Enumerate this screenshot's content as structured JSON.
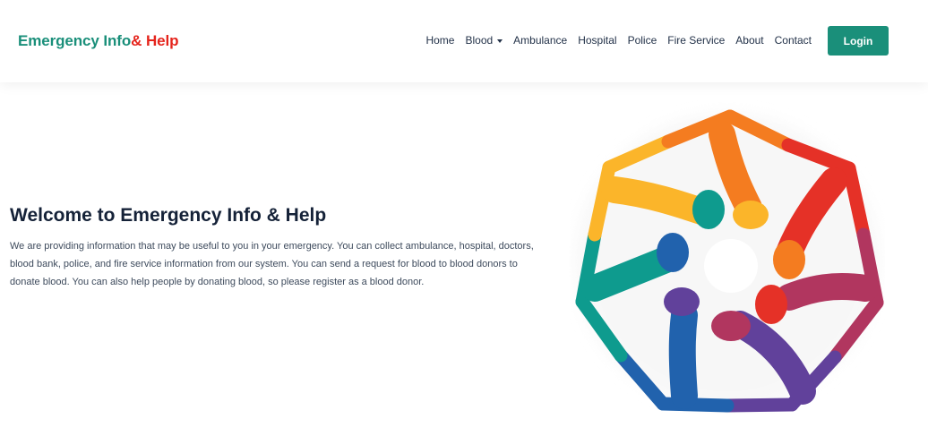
{
  "header": {
    "brand_text": "Emergency Info",
    "brand_amp": "& Help",
    "nav": [
      {
        "label": "Home"
      },
      {
        "label": "Blood",
        "dropdown": true
      },
      {
        "label": "Ambulance"
      },
      {
        "label": "Hospital"
      },
      {
        "label": "Police"
      },
      {
        "label": "Fire Service"
      },
      {
        "label": "About"
      },
      {
        "label": "Contact"
      }
    ],
    "login_label": "Login"
  },
  "hero": {
    "title": "Welcome to Emergency Info & Help",
    "description": "We are providing information that may be useful to you in your emergency. You can collect ambulance, hospital, doctors, blood bank, police, and fire service information from our system. You can send a request for blood to blood donors to donate blood. You can also help people by donating blood, so please register as a blood donor.",
    "illustration": "heptagon-hands-illustration"
  },
  "colors": {
    "brand": "#1a8f7a",
    "brand_accent": "#e5241c",
    "text_dark": "#152238",
    "hand_colors": [
      "#f47c20",
      "#e53127",
      "#b1365f",
      "#61419b",
      "#2162ad",
      "#0e9b8e",
      "#fbb52a"
    ]
  }
}
